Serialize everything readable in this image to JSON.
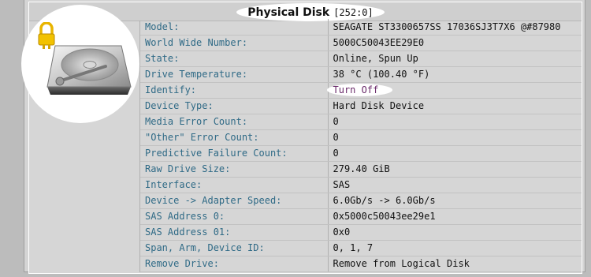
{
  "title": "Physical Disk",
  "title_id": "[252:0]",
  "rows": [
    {
      "label": "Model:",
      "value": "SEAGATE ST3300657SS 17036SJ3T7X6 @#87980"
    },
    {
      "label": "World Wide Number:",
      "value": "5000C50043EE29E0"
    },
    {
      "label": "State:",
      "value": "Online, Spun Up"
    },
    {
      "label": "Drive Temperature:",
      "value": "38 °C (100.40 °F)"
    },
    {
      "label": "Identify:",
      "value": "Turn Off"
    },
    {
      "label": "Device Type:",
      "value": "Hard Disk Device"
    },
    {
      "label": "Media Error Count:",
      "value": "0"
    },
    {
      "label": "\"Other\" Error Count:",
      "value": "0"
    },
    {
      "label": "Predictive Failure Count:",
      "value": "0"
    },
    {
      "label": "Raw Drive Size:",
      "value": "279.40 GiB"
    },
    {
      "label": "Interface:",
      "value": "SAS"
    },
    {
      "label": "Device -> Adapter Speed:",
      "value": "6.0Gb/s -> 6.0Gb/s"
    },
    {
      "label": "SAS Address 0:",
      "value": "0x5000c50043ee29e1"
    },
    {
      "label": "SAS Address 01:",
      "value": "0x0"
    },
    {
      "label": "Span, Arm, Device ID:",
      "value": "0, 1, 7"
    },
    {
      "label": "Remove Drive:",
      "value": "Remove from Logical Disk"
    }
  ],
  "icons": {
    "disk": "hard-disk-icon",
    "lock": "padlock-icon"
  },
  "colors": {
    "label": "#2f6a86",
    "ok": "#2a8a2a",
    "action": "#6a2a6a"
  }
}
